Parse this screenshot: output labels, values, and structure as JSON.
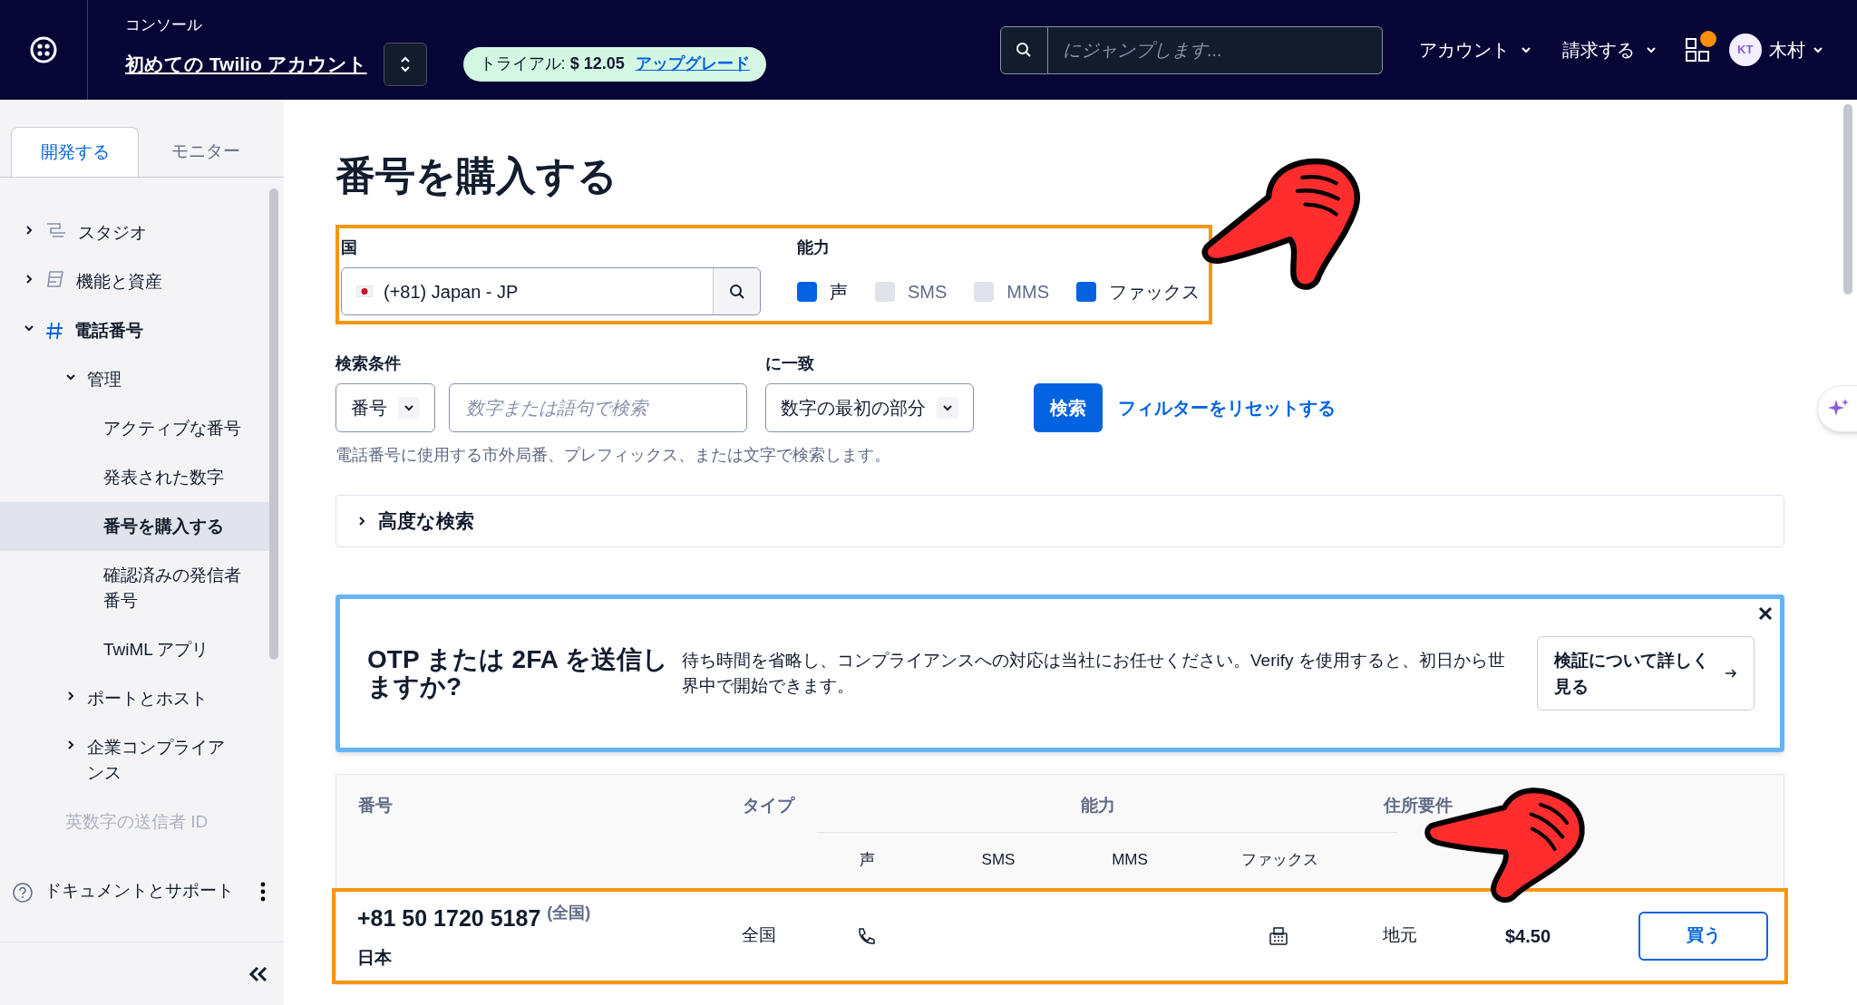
{
  "header": {
    "console_label": "コンソール",
    "account_name": "初めての Twilio アカウント",
    "trial": {
      "label": "トライアル:",
      "amount": "$ 12.05",
      "link": "アップグレード"
    },
    "search": {
      "placeholder": "にジャンプします..."
    },
    "nav": [
      {
        "label": "アカウント"
      },
      {
        "label": "請求する"
      }
    ],
    "apps_notification": true,
    "user": {
      "initials": "KT",
      "name": "木村"
    }
  },
  "sidebar": {
    "tabs": [
      {
        "label": "開発する",
        "selected": true
      },
      {
        "label": "モニター",
        "selected": false
      }
    ],
    "items": [
      {
        "label": "スタジオ",
        "expanded": false,
        "selected": false
      },
      {
        "label": "機能と資産",
        "expanded": false,
        "selected": false
      },
      {
        "label": "電話番号",
        "expanded": true,
        "selected": false,
        "children": [
          {
            "label": "管理",
            "expanded": true,
            "selected": false,
            "children": [
              {
                "label": "アクティブな番号",
                "selected": false
              },
              {
                "label": "発表された数字",
                "selected": false
              },
              {
                "label": "番号を購入する",
                "selected": true
              },
              {
                "label": "確認済みの発信者番号",
                "selected": false
              },
              {
                "label": "TwiML アプリ",
                "selected": false
              }
            ]
          },
          {
            "label": "ポートとホスト",
            "expanded": false,
            "selected": false
          },
          {
            "label": "企業コンプライアンス",
            "expanded": false,
            "selected": false
          },
          {
            "label": "英数字の送信者 ID",
            "disabled": true,
            "selected": false
          }
        ]
      }
    ],
    "footer": {
      "label": "ドキュメントとサポート"
    }
  },
  "main": {
    "title": "番号を購入する",
    "filters": {
      "highlighted": true,
      "country": {
        "label": "国",
        "value": "(+81) Japan - JP"
      },
      "capabilities": {
        "label": "能力",
        "options": [
          {
            "label": "声",
            "checked": true
          },
          {
            "label": "SMS",
            "checked": false
          },
          {
            "label": "MMS",
            "checked": false
          },
          {
            "label": "ファックス",
            "checked": true
          }
        ]
      }
    },
    "search_by": {
      "label": "検索条件",
      "value": "番号"
    },
    "search_field": {
      "placeholder": "数字または語句で検索"
    },
    "match": {
      "label": "に一致",
      "value": "数字の最初の部分"
    },
    "search_button": "検索",
    "reset_link": "フィルターをリセットする",
    "hint": "電話番号に使用する市外局番、プレフィックス、または文字で検索します。",
    "advanced_search": {
      "label": "高度な検索",
      "expanded": false
    },
    "promo": {
      "title": "OTP または 2FA を送信しますか?",
      "text": "待ち時間を省略し、コンプライアンスへの対応は当社にお任せください。Verify を使用すると、初日から世界中で開始できます。",
      "button": "検証について詳しく見る"
    },
    "table": {
      "columns": {
        "number": "番号",
        "type": "タイプ",
        "capabilities": "能力",
        "address": "住所要件"
      },
      "capability_columns": [
        "声",
        "SMS",
        "MMS",
        "ファックス"
      ],
      "rows": [
        {
          "number": "+81 50 1720 5187",
          "scope": "(全国)",
          "country": "日本",
          "type": "全国",
          "voice": true,
          "sms": false,
          "mms": false,
          "fax": true,
          "address": "地元",
          "price": "$4.50",
          "action": "買う",
          "highlighted": true
        }
      ]
    }
  }
}
